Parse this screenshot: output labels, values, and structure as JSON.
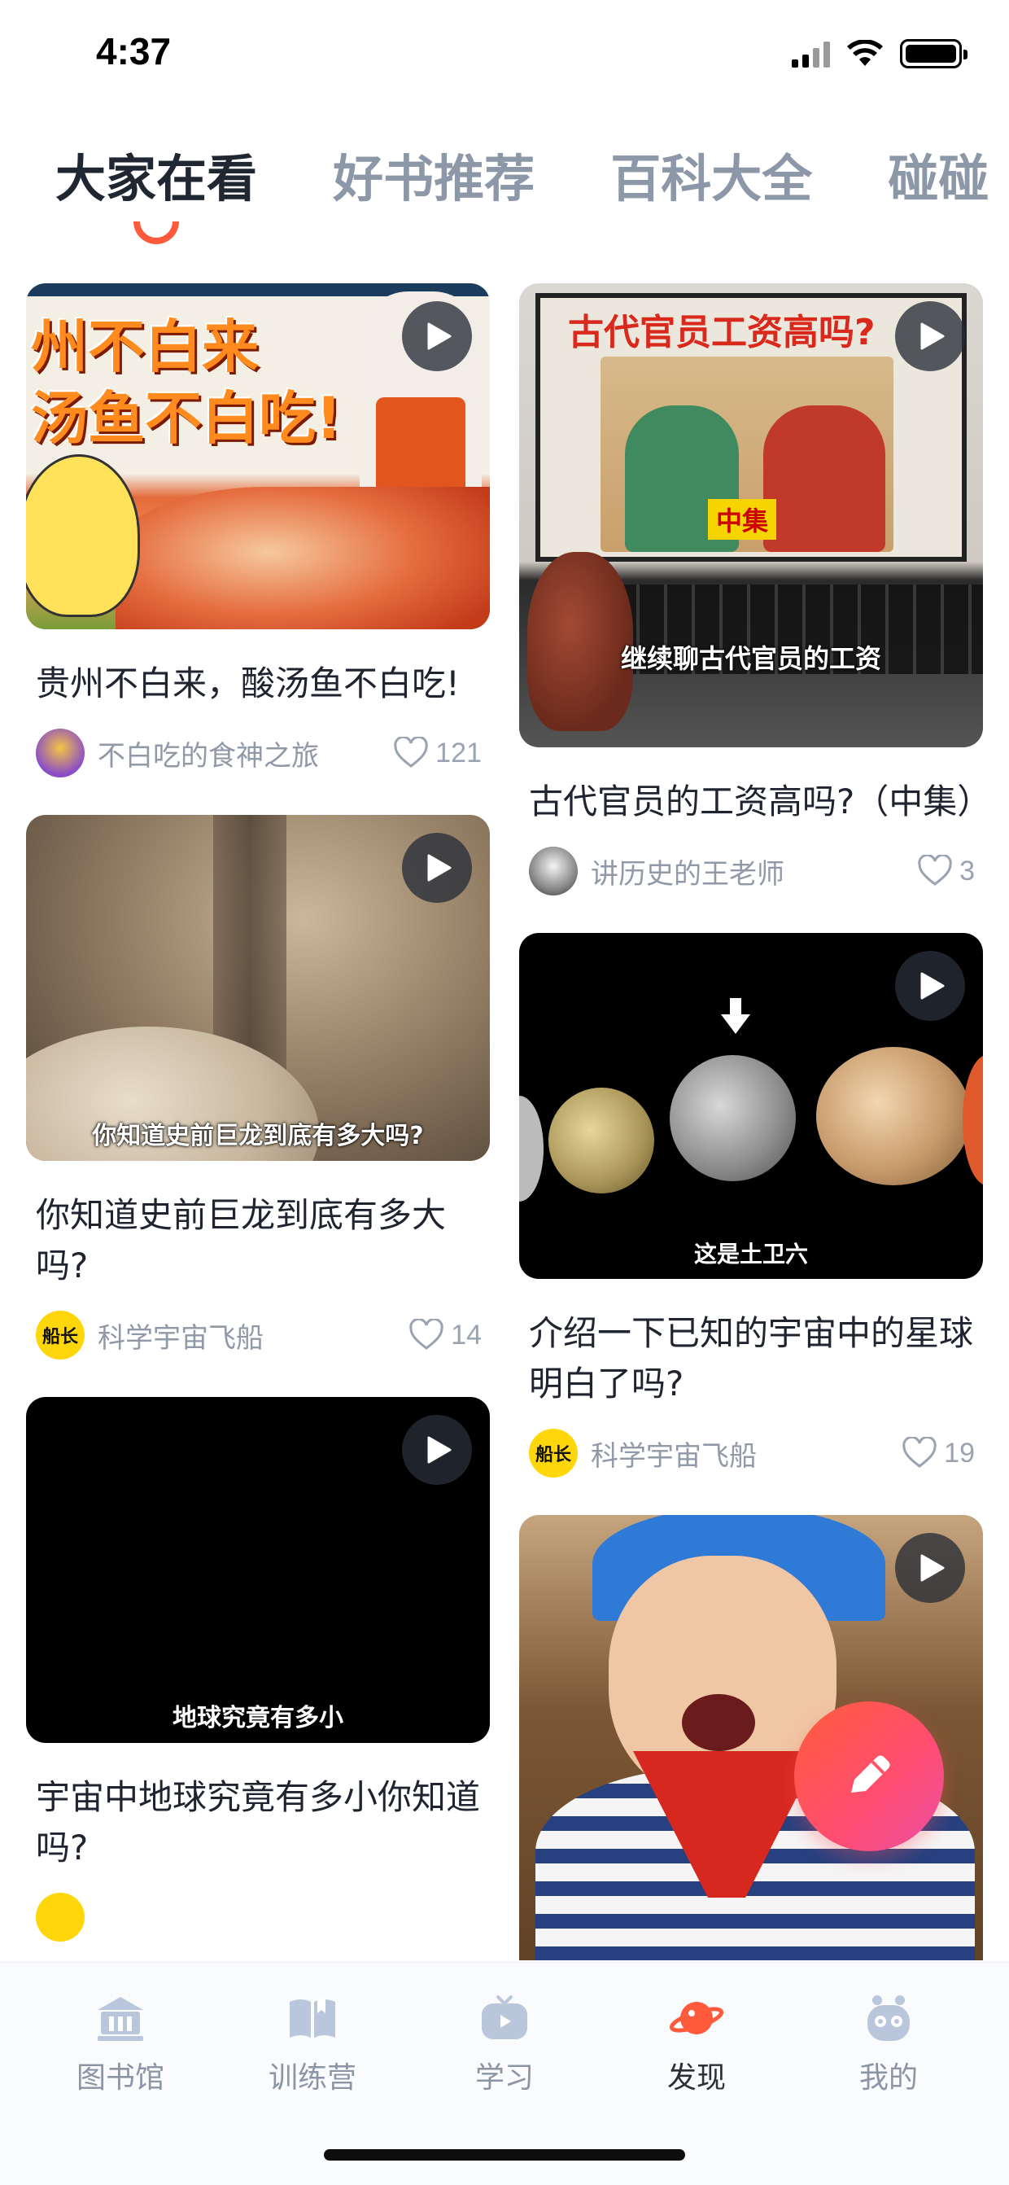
{
  "status_bar": {
    "time": "4:37"
  },
  "tabs": [
    {
      "label": "大家在看",
      "active": true
    },
    {
      "label": "好书推荐",
      "active": false
    },
    {
      "label": "百科大全",
      "active": false
    },
    {
      "label": "碰碰",
      "active": false
    }
  ],
  "feed": {
    "left": [
      {
        "title": "贵州不白来，酸汤鱼不白吃!",
        "author": "不白吃的食神之旅",
        "likes": "121",
        "thumb_text": [
          "州不白来",
          "汤鱼不白吃!"
        ],
        "caption": ""
      },
      {
        "title": "你知道史前巨龙到底有多大吗?",
        "author": "科学宇宙飞船",
        "likes": "14",
        "caption": "你知道史前巨龙到底有多大吗?",
        "avatar_text": "船长"
      },
      {
        "title": "宇宙中地球究竟有多小你知道吗?",
        "author": "",
        "likes": "",
        "caption": "地球究竟有多小"
      }
    ],
    "right": [
      {
        "title": "古代官员的工资高吗?（中集）",
        "author": "讲历史的王老师",
        "likes": "3",
        "caption": "继续聊古代官员的工资",
        "thumb_title": "古代官员工资高吗?",
        "thumb_badge": "中集"
      },
      {
        "title": "介绍一下已知的宇宙中的星球明白了吗?",
        "author": "科学宇宙飞船",
        "likes": "19",
        "caption": "这是土卫六",
        "avatar_text": "船长"
      },
      {
        "title": "",
        "author": "",
        "likes": "",
        "caption": ""
      }
    ]
  },
  "fab": {
    "icon": "pencil-icon"
  },
  "bottom_nav": [
    {
      "label": "图书馆",
      "icon": "library-icon",
      "active": false
    },
    {
      "label": "训练营",
      "icon": "book-icon",
      "active": false
    },
    {
      "label": "学习",
      "icon": "tv-icon",
      "active": false
    },
    {
      "label": "发现",
      "icon": "planet-icon",
      "active": true
    },
    {
      "label": "我的",
      "icon": "robot-icon",
      "active": false
    }
  ],
  "colors": {
    "accent": "#ff5a3c",
    "active_text": "#1f2733",
    "inactive_text": "#8c97a8"
  }
}
